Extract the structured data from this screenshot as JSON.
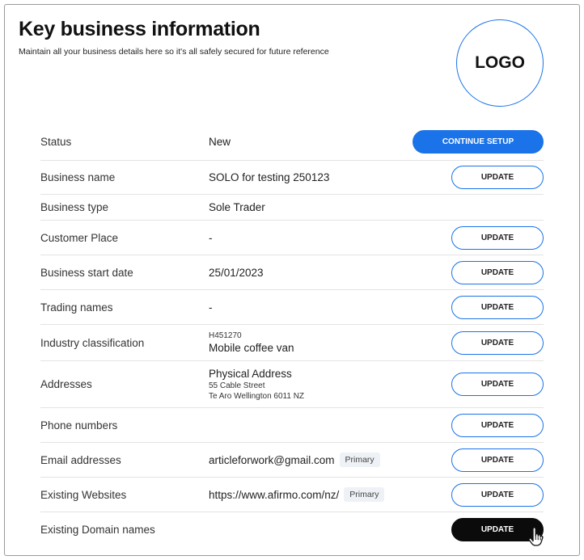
{
  "header": {
    "title": "Key business information",
    "subtitle": "Maintain all your business details here so it's all safely secured for future reference",
    "logo_text": "LOGO"
  },
  "rows": [
    {
      "label": "Status",
      "value": "New",
      "button": "CONTINUE SETUP"
    },
    {
      "label": "Business name",
      "value": "SOLO for testing 250123",
      "button": "UPDATE"
    },
    {
      "label": "Business type",
      "value": "Sole Trader"
    },
    {
      "label": "Customer Place",
      "value": "-",
      "button": "UPDATE"
    },
    {
      "label": "Business start date",
      "value": "25/01/2023",
      "button": "UPDATE"
    },
    {
      "label": "Trading names",
      "value": "-",
      "button": "UPDATE"
    },
    {
      "label": "Industry classification",
      "code": "H451270",
      "value": "Mobile coffee van",
      "button": "UPDATE"
    },
    {
      "label": "Addresses",
      "value": "Physical Address",
      "line1": "55 Cable Street",
      "line2": "Te Aro Wellington 6011 NZ",
      "button": "UPDATE"
    },
    {
      "label": "Phone numbers",
      "button": "UPDATE"
    },
    {
      "label": "Email addresses",
      "value": "articleforwork@gmail.com",
      "badge": "Primary",
      "button": "UPDATE"
    },
    {
      "label": "Existing Websites",
      "value": "https://www.afirmo.com/nz/",
      "badge": "Primary",
      "button": "UPDATE"
    },
    {
      "label": "Existing Domain names",
      "button": "UPDATE"
    }
  ],
  "colors": {
    "accent": "#1a73e8",
    "dark_button": "#0b0b0b",
    "badge_bg": "#eef1f5"
  },
  "icons": {
    "cursor": "hand-pointer-icon"
  }
}
